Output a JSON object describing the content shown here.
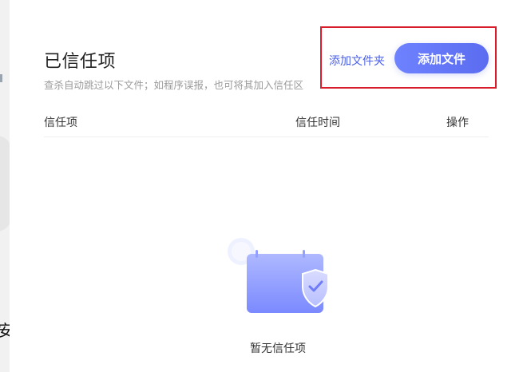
{
  "background": {
    "partial_text": "安"
  },
  "dialog": {
    "title": "已信任项",
    "subtitle": "查杀自动跳过以下文件；如程序误报，也可将其加入信任区",
    "actions": {
      "add_folder": "添加文件夹",
      "add_file": "添加文件"
    },
    "table": {
      "columns": [
        "信任项",
        "信任时间",
        "操作"
      ]
    },
    "empty_state": {
      "text": "暂无信任项",
      "icon": "calendar-shield-icon"
    }
  },
  "colors": {
    "primary": "#5b6cf0",
    "highlight_border": "#d81d2c",
    "title": "#222222",
    "subtitle": "#9b9b9b"
  }
}
